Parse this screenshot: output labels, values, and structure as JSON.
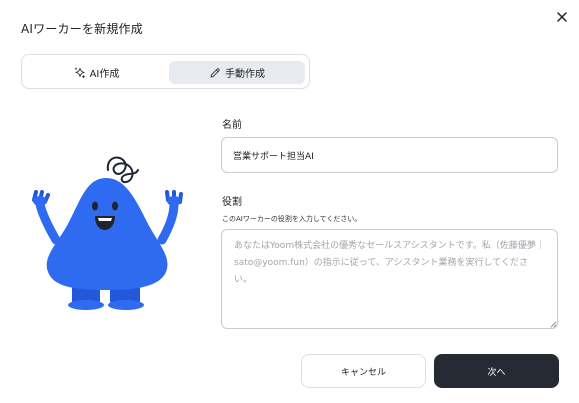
{
  "dialog": {
    "title": "AIワーカーを新規作成"
  },
  "tabs": [
    {
      "label": "AI作成",
      "icon": "sparkle-icon",
      "selected": false
    },
    {
      "label": "手動作成",
      "icon": "pencil-icon",
      "selected": true
    }
  ],
  "form": {
    "name_label": "名前",
    "name_value": "営業サポート担当AI",
    "role_label": "役割",
    "role_hint": "このAIワーカーの役割を入力してください。",
    "role_placeholder": "あなたはYoom株式会社の優秀なセールスアシスタントです。私（佐藤優夢｜sato@yoom.fun）の指示に従って、アシスタント業務を実行してください。"
  },
  "buttons": {
    "cancel_label": "キャンセル",
    "next_label": "次へ"
  },
  "colors": {
    "accent_dark": "#262a33",
    "tab_selected_bg": "#e7eaee",
    "mascot_blue": "#2f6bf0",
    "mascot_blue_dark": "#2358d9"
  }
}
